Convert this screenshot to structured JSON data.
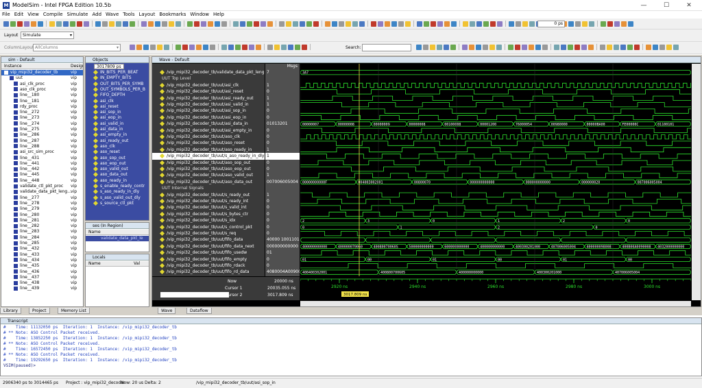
{
  "window": {
    "title": "ModelSim - Intel FPGA Edition 10.5b",
    "logo": "M"
  },
  "window_controls": {
    "min": "—",
    "max": "☐",
    "close": "✕"
  },
  "menu": [
    "File",
    "Edit",
    "View",
    "Compile",
    "Simulate",
    "Add",
    "Wave",
    "Tools",
    "Layout",
    "Bookmarks",
    "Window",
    "Help"
  ],
  "toolbar": {
    "layout_label": "Layout",
    "layout_value": "Simulate",
    "column_layout_label": "ColumnLayout",
    "column_layout_value": "AllColumns",
    "search_label": "Search:",
    "time_value": "0",
    "time_unit": "ps"
  },
  "sim_pane": {
    "title": "sim - Default",
    "col_instance": "Instance",
    "col_design": "Design",
    "items": [
      {
        "name": "vip_mipi32_decoder_tb",
        "design": "vip"
      },
      {
        "name": "uut",
        "design": "vip"
      },
      {
        "name": "asi_clk_proc",
        "design": "vip"
      },
      {
        "name": "aso_clk_proc",
        "design": "vip"
      },
      {
        "name": "line__180",
        "design": "vip"
      },
      {
        "name": "line__181",
        "design": "vip"
      },
      {
        "name": "rdy_proc",
        "design": "vip"
      },
      {
        "name": "line__272",
        "design": "vip"
      },
      {
        "name": "line__273",
        "design": "vip"
      },
      {
        "name": "line__274",
        "design": "vip"
      },
      {
        "name": "line__275",
        "design": "vip"
      },
      {
        "name": "line__286",
        "design": "vip"
      },
      {
        "name": "line__287",
        "design": "vip"
      },
      {
        "name": "line__288",
        "design": "vip"
      },
      {
        "name": "asi_src_sim_proc",
        "design": "vip"
      },
      {
        "name": "line__431",
        "design": "vip"
      },
      {
        "name": "line__441",
        "design": "vip"
      },
      {
        "name": "line__442",
        "design": "vip"
      },
      {
        "name": "line__445",
        "design": "vip"
      },
      {
        "name": "line__448",
        "design": "vip"
      },
      {
        "name": "validate_ctl_pkt_proc",
        "design": "vip"
      },
      {
        "name": "validate_data_pkt_leng...",
        "design": "vip"
      },
      {
        "name": "line__277",
        "design": "vip"
      },
      {
        "name": "line__278",
        "design": "vip"
      },
      {
        "name": "line__279",
        "design": "vip"
      },
      {
        "name": "line__280",
        "design": "vip"
      },
      {
        "name": "line__281",
        "design": "vip"
      },
      {
        "name": "line__282",
        "design": "vip"
      },
      {
        "name": "line__283",
        "design": "vip"
      },
      {
        "name": "line__284",
        "design": "vip"
      },
      {
        "name": "line__285",
        "design": "vip"
      },
      {
        "name": "line__432",
        "design": "vip"
      },
      {
        "name": "line__433",
        "design": "vip"
      },
      {
        "name": "line__434",
        "design": "vip"
      },
      {
        "name": "line__435",
        "design": "vip"
      },
      {
        "name": "line__436",
        "design": "vip"
      },
      {
        "name": "line__437",
        "design": "vip"
      },
      {
        "name": "line__438",
        "design": "vip"
      },
      {
        "name": "line__439",
        "design": "vip"
      }
    ]
  },
  "objects_pane": {
    "title": "Objects",
    "time_chip": "3017809 ps",
    "items": [
      "IN_BITS_PER_BEAT",
      "IN_EMPTY_BITS",
      "OUT_BITS_PER_SYMB",
      "OUT_SYMBOLS_PER_B",
      "FIFO_DEPTH",
      "asi_clk",
      "asi_reset",
      "asi_sop_in",
      "asi_eop_in",
      "asi_valid_in",
      "asi_data_in",
      "asi_empty_in",
      "asi_ready_out",
      "aso_clk",
      "aso_reset",
      "aso_sop_out",
      "aso_eop_out",
      "aso_valid_out",
      "aso_data_out",
      "aso_ready_in",
      "s_enable_ready_contr",
      "s_aso_ready_in_dly",
      "s_aso_valid_out_dly",
      "s_source_ctl_pkt"
    ]
  },
  "processes_pane": {
    "title": "ses (In Region)",
    "col_name": "Name",
    "item": "validate_data_pkt_le"
  },
  "locals_pane": {
    "title": "Locals",
    "col_name": "Name",
    "col_value": "Val"
  },
  "wave": {
    "title": "Wave - Default",
    "msgs_label": "Msgs",
    "signals": [
      {
        "name": "/vip_mipi32_decoder_tb/validate_data_pkt_leng...",
        "value": "7"
      },
      {
        "name": "UUT Top Level",
        "value": "",
        "divider": true
      },
      {
        "name": "/vip_mipi32_decoder_tb/uut/asi_clk",
        "value": "1"
      },
      {
        "name": "/vip_mipi32_decoder_tb/uut/asi_reset",
        "value": "0"
      },
      {
        "name": "/vip_mipi32_decoder_tb/uut/asi_ready_out",
        "value": "1"
      },
      {
        "name": "/vip_mipi32_decoder_tb/uut/asi_valid_in",
        "value": "1"
      },
      {
        "name": "/vip_mipi32_decoder_tb/uut/asi_sop_in",
        "value": "0"
      },
      {
        "name": "/vip_mipi32_decoder_tb/uut/asi_eop_in",
        "value": "0"
      },
      {
        "name": "/vip_mipi32_decoder_tb/uut/asi_data_in",
        "value": "01013201"
      },
      {
        "name": "/vip_mipi32_decoder_tb/uut/asi_empty_in",
        "value": "0"
      },
      {
        "name": "/vip_mipi32_decoder_tb/uut/aso_clk",
        "value": "0"
      },
      {
        "name": "/vip_mipi32_decoder_tb/uut/aso_reset",
        "value": "0"
      },
      {
        "name": "/vip_mipi32_decoder_tb/uut/aso_ready_in",
        "value": "1"
      },
      {
        "name": "/vip_mipi32_decoder_tb/uut/s_aso_ready_in_dly",
        "value": "1"
      },
      {
        "name": "/vip_mipi32_decoder_tb/uut/aso_sop_out",
        "value": "0"
      },
      {
        "name": "/vip_mipi32_decoder_tb/uut/aso_eop_out",
        "value": "0"
      },
      {
        "name": "/vip_mipi32_decoder_tb/uut/aso_valid_out",
        "value": "1"
      },
      {
        "name": "/vip_mipi32_decoder_tb/uut/aso_data_out",
        "value": "007006005004"
      },
      {
        "name": "UUT Internal Signals",
        "value": "",
        "divider": true
      },
      {
        "name": "/vip_mipi32_decoder_tb/uut/s_ready_out",
        "value": "1"
      },
      {
        "name": "/vip_mipi32_decoder_tb/uut/s_ready_int",
        "value": "0"
      },
      {
        "name": "/vip_mipi32_decoder_tb/uut/s_valid_int",
        "value": "0"
      },
      {
        "name": "/vip_mipi32_decoder_tb/uut/s_bytes_ctr",
        "value": "0"
      },
      {
        "name": "/vip_mipi32_decoder_tb/uut/s_idx",
        "value": "0"
      },
      {
        "name": "/vip_mipi32_decoder_tb/uut/s_control_pkt",
        "value": "0"
      },
      {
        "name": "/vip_mipi32_decoder_tb/uut/s_req",
        "value": "0"
      },
      {
        "name": "/vip_mipi32_decoder_tb/uut/fifo_data",
        "value": "40000 10011010"
      },
      {
        "name": "/vip_mipi32_decoder_tb/uut/fifo_data_next",
        "value": "000000000000"
      },
      {
        "name": "/vip_mipi32_decoder_tb/uut/fifo_usedw",
        "value": "01"
      },
      {
        "name": "/vip_mipi32_decoder_tb/uut/fifo_empty",
        "value": "0"
      },
      {
        "name": "/vip_mipi32_decoder_tb/uut/fifo_rdack",
        "value": "0"
      },
      {
        "name": "/vip_mipi32_decoder_tb/uut/fifo_rd_data",
        "value": "4080004A009008"
      }
    ],
    "now_label": "Now",
    "now_value": "20000 ns",
    "cursor1_label": "Cursor 1",
    "cursor1_value": "20035.055 ns",
    "cursor2_label": "Cursor 2",
    "cursor2_value": "3017.809 ns",
    "time_ticks": [
      "2920 ns",
      "2940 ns",
      "2960 ns",
      "2980 ns",
      "3000 ns"
    ],
    "bus_labels": {
      "r0": [
        "3A7"
      ],
      "r8": [
        "00000007",
        "00000008",
        "00000009",
        "00000008",
        "00100008",
        "00001200",
        "76000054",
        "00980000",
        "00000BA00",
        "FE00000C",
        "01100101"
      ],
      "r17": [
        "00000000000F",
        "004003002001",
        "00800070",
        "000000000000",
        "000000000000",
        "000000020",
        "007006005004"
      ],
      "r23": [
        "2",
        "3",
        "0",
        "1",
        "2",
        "0"
      ],
      "r24": [
        "0",
        "1",
        "2",
        "0"
      ],
      "r27": [
        "400000000000",
        "400000070060",
        "40080070060S",
        "500000000000",
        "600000000000",
        "400000000000",
        "400300201000",
        "407006005004",
        "400000098008",
        "400B00A0090008",
        "4032000000000"
      ],
      "r29": [
        "01",
        "00",
        "01",
        "00",
        "01",
        "00"
      ],
      "r31": [
        "400400302001",
        "400800700605",
        "400000000000",
        "400300201000",
        "407006005004"
      ]
    }
  },
  "bottom_tabs": [
    "Library",
    "Project",
    "Memory List",
    "Wave",
    "Dataflow"
  ],
  "transcript": {
    "title": "Transcript",
    "lines": [
      "#    Time: 11132050 ps  Iteration: 1  Instance: /vip_mipi32_decoder_tb",
      "# ** Note: ASO Control Packet received.",
      "#    Time: 13852250 ps  Iteration: 1  Instance: /vip_mipi32_decoder_tb",
      "# ** Note: ASO Control Packet received.",
      "#    Time: 16572450 ps  Iteration: 1  Instance: /vip_mipi32_decoder_tb",
      "# ** Note: ASO Control Packet received.",
      "#    Time: 19292650 ps  Iteration: 1  Instance: /vip_mipi32_decoder_tb",
      "",
      "VSIM(paused)>"
    ]
  },
  "status": {
    "range": "2906340 ps to 3014465 ps",
    "project": "Project : vip_mipi32_decoder",
    "now": "Now: 20 us  Delta: 2",
    "path": "/vip_mipi32_decoder_tb/uut/asi_sop_in"
  }
}
